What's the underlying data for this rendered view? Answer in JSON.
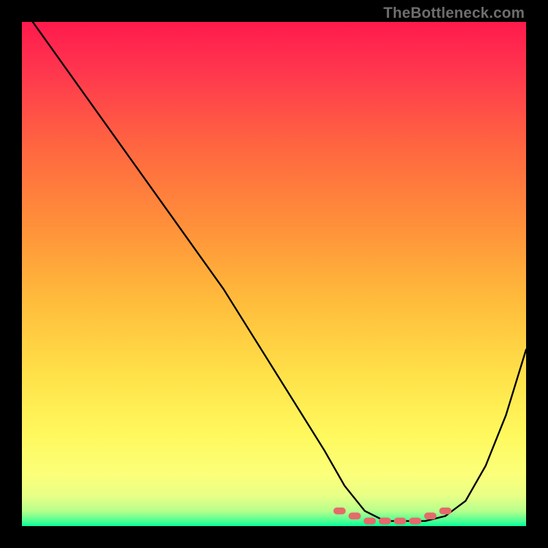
{
  "watermark": "TheBottleneck.com",
  "chart_data": {
    "type": "line",
    "title": "",
    "xlabel": "",
    "ylabel": "",
    "xlim": [
      0,
      100
    ],
    "ylim": [
      0,
      100
    ],
    "series": [
      {
        "name": "bottleneck-curve",
        "x": [
          0,
          5,
          10,
          15,
          20,
          25,
          30,
          35,
          40,
          45,
          50,
          55,
          60,
          64,
          68,
          72,
          76,
          80,
          84,
          88,
          92,
          96,
          100
        ],
        "values": [
          103,
          96,
          89,
          82,
          75,
          68,
          61,
          54,
          47,
          39,
          31,
          23,
          15,
          8,
          3,
          1,
          1,
          1,
          2,
          5,
          12,
          22,
          35
        ]
      },
      {
        "name": "optimal-band-markers",
        "x": [
          63,
          66,
          69,
          72,
          75,
          78,
          81,
          84
        ],
        "values": [
          3,
          2,
          1,
          1,
          1,
          1,
          2,
          3
        ]
      }
    ],
    "gradient_stops": [
      {
        "pos": 0.0,
        "color": "#ff1a4d"
      },
      {
        "pos": 0.1,
        "color": "#ff374e"
      },
      {
        "pos": 0.25,
        "color": "#ff6740"
      },
      {
        "pos": 0.4,
        "color": "#ff8f3a"
      },
      {
        "pos": 0.55,
        "color": "#ffbb3b"
      },
      {
        "pos": 0.7,
        "color": "#ffe149"
      },
      {
        "pos": 0.82,
        "color": "#fff95e"
      },
      {
        "pos": 0.9,
        "color": "#fbff7a"
      },
      {
        "pos": 0.94,
        "color": "#e8ff86"
      },
      {
        "pos": 0.97,
        "color": "#b7ff8c"
      },
      {
        "pos": 0.99,
        "color": "#4dff93"
      },
      {
        "pos": 1.0,
        "color": "#00ff99"
      }
    ],
    "marker_color": "#e56a6a",
    "curve_color": "#000000"
  }
}
